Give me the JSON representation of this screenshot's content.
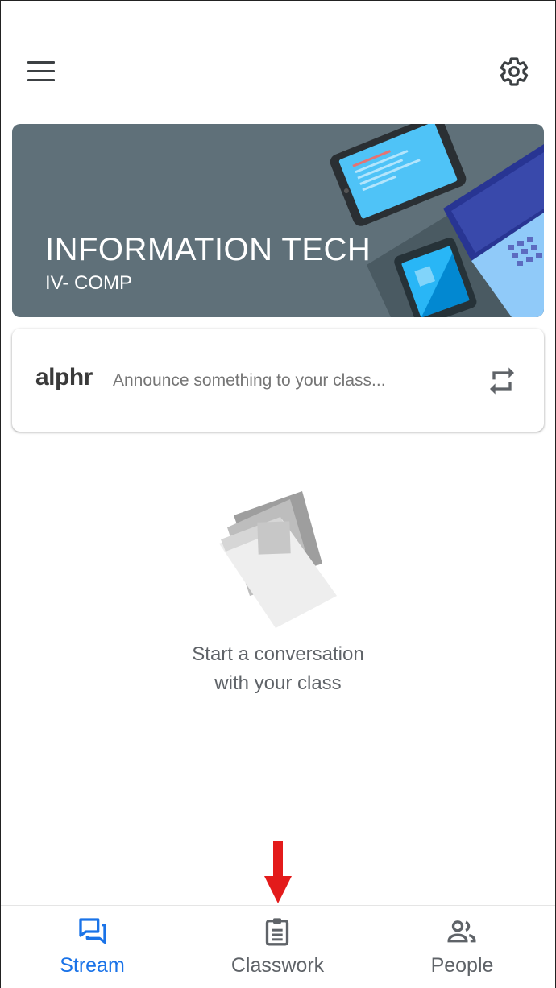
{
  "colors": {
    "accent": "#1a73e8",
    "banner_bg": "#5f7079",
    "annotation_arrow": "#e31b1b"
  },
  "topbar": {
    "menu_icon": "hamburger-menu-icon",
    "settings_icon": "gear-icon"
  },
  "banner": {
    "title": "INFORMATION TECH",
    "subtitle": "IV- COMP"
  },
  "announce": {
    "logo_text": "alphr",
    "placeholder": "Announce something to your class...",
    "repost_icon": "repost-icon"
  },
  "empty_state": {
    "line1": "Start a conversation",
    "line2": "with your class"
  },
  "bottom_nav": {
    "items": [
      {
        "label": "Stream",
        "icon": "stream-icon",
        "active": true
      },
      {
        "label": "Classwork",
        "icon": "clipboard-icon",
        "active": false
      },
      {
        "label": "People",
        "icon": "people-icon",
        "active": false
      }
    ]
  }
}
